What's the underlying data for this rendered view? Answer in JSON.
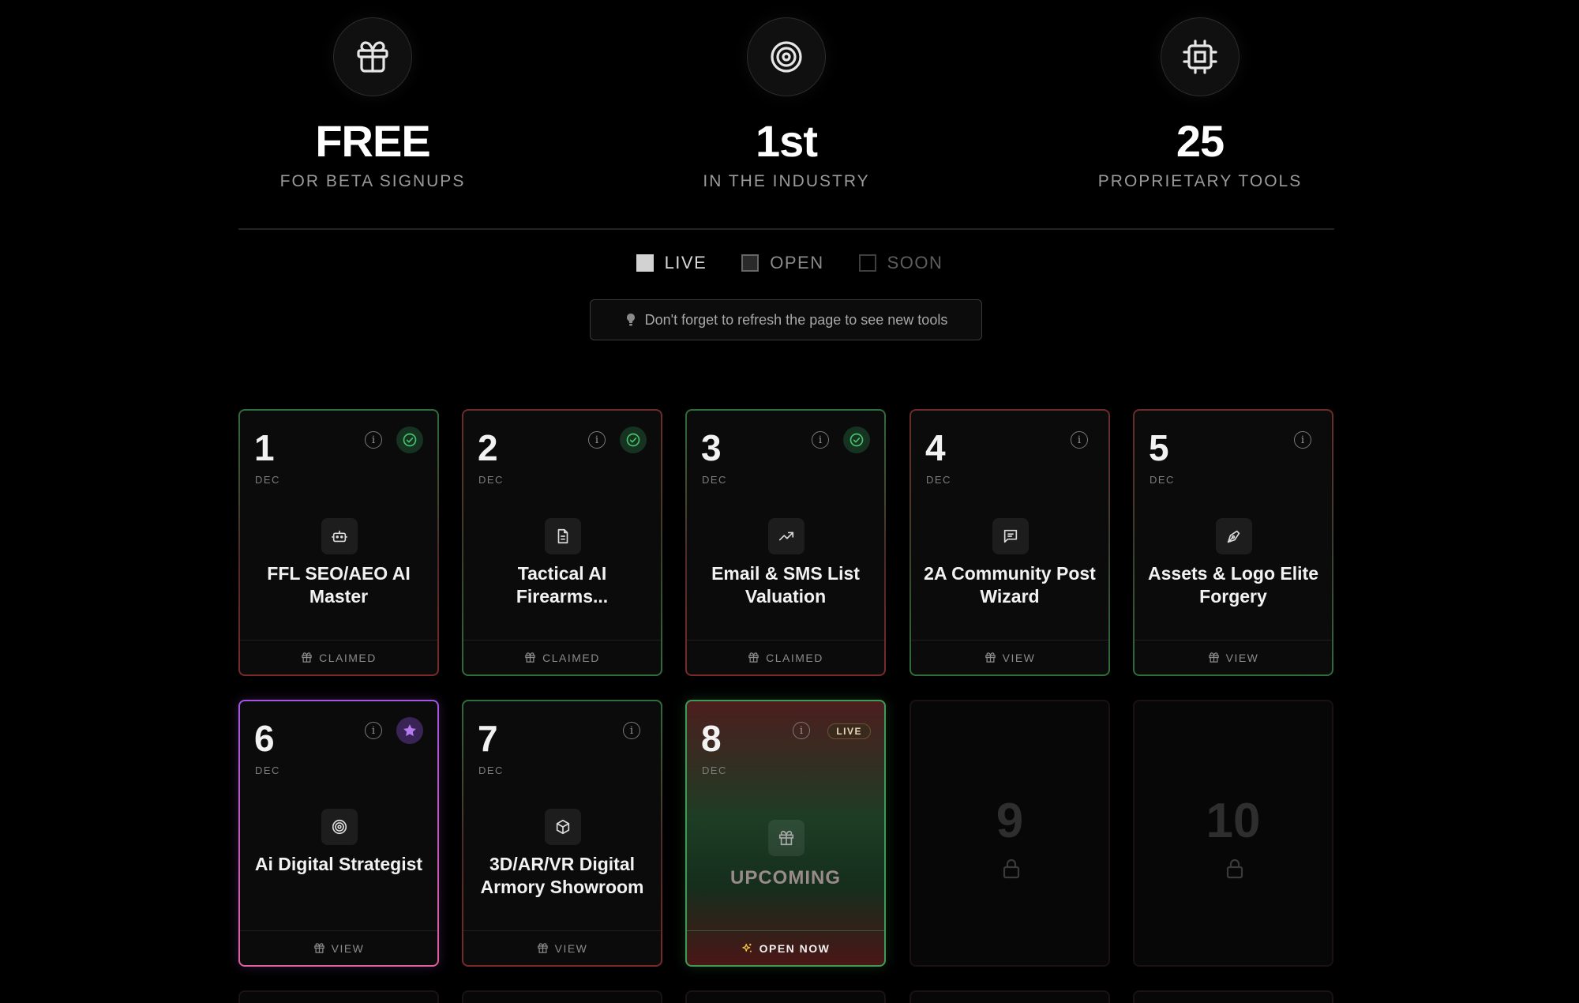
{
  "stats": [
    {
      "value": "FREE",
      "label": "FOR BETA SIGNUPS",
      "icon": "gift-icon"
    },
    {
      "value": "1st",
      "label": "IN THE INDUSTRY",
      "icon": "target-icon"
    },
    {
      "value": "25",
      "label": "PROPRIETARY TOOLS",
      "icon": "chip-icon"
    }
  ],
  "legend": {
    "live": "LIVE",
    "open": "OPEN",
    "soon": "SOON"
  },
  "notice": "Don't forget to refresh the page to see new tools",
  "cards": [
    {
      "num": "1",
      "month": "DEC",
      "title": "FFL SEO/AEO AI Master",
      "footer": "CLAIMED",
      "icon": "robot-icon",
      "status": "claimed"
    },
    {
      "num": "2",
      "month": "DEC",
      "title": "Tactical AI Firearms...",
      "footer": "CLAIMED",
      "icon": "document-icon",
      "status": "claimed"
    },
    {
      "num": "3",
      "month": "DEC",
      "title": "Email & SMS List Valuation",
      "footer": "CLAIMED",
      "icon": "trending-up-icon",
      "status": "claimed"
    },
    {
      "num": "4",
      "month": "DEC",
      "title": "2A Community Post Wizard",
      "footer": "VIEW",
      "icon": "message-icon",
      "status": "open"
    },
    {
      "num": "5",
      "month": "DEC",
      "title": "Assets & Logo Elite Forgery",
      "footer": "VIEW",
      "icon": "pen-tool-icon",
      "status": "open"
    },
    {
      "num": "6",
      "month": "DEC",
      "title": "Ai Digital Strategist",
      "footer": "VIEW",
      "icon": "target-icon",
      "status": "featured"
    },
    {
      "num": "7",
      "month": "DEC",
      "title": "3D/AR/VR Digital Armory Showroom",
      "footer": "VIEW",
      "icon": "cube-icon",
      "status": "open"
    },
    {
      "num": "8",
      "month": "DEC",
      "title": "UPCOMING",
      "footer": "OPEN NOW",
      "badge": "LIVE",
      "icon": "gift-icon",
      "status": "live"
    },
    {
      "num": "9",
      "status": "locked"
    },
    {
      "num": "10",
      "status": "locked"
    }
  ],
  "colors": {
    "background": "#000000",
    "claimed_green": "#3fb95f",
    "featured_purple": "#a855f7",
    "live_border": "#3e9b55"
  }
}
